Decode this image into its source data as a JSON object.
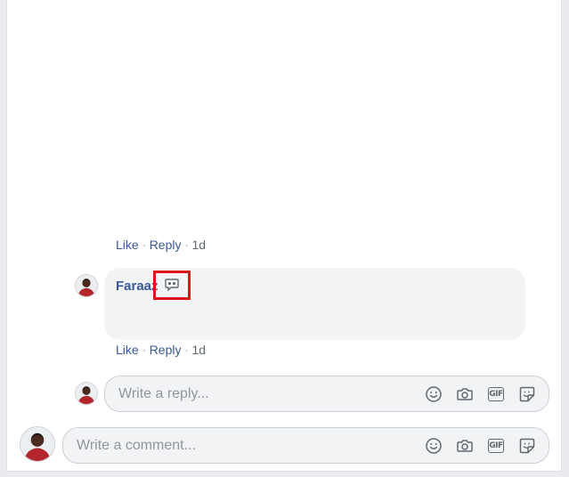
{
  "comment_1": {
    "like_label": "Like",
    "reply_label": "Reply",
    "separator": "·",
    "time": "1d"
  },
  "comment_2": {
    "author": "Faraaz",
    "like_label": "Like",
    "reply_label": "Reply",
    "separator": "·",
    "time": "1d"
  },
  "reply_box": {
    "placeholder": "Write a reply..."
  },
  "comment_box": {
    "placeholder": "Write a comment..."
  },
  "icons": [
    "emoji-icon",
    "camera-icon",
    "gif-icon",
    "sticker-icon"
  ],
  "gif_text": "GIF",
  "colors": {
    "link": "#385898",
    "bubble": "#f2f3f5",
    "highlight": "#e0121a"
  }
}
